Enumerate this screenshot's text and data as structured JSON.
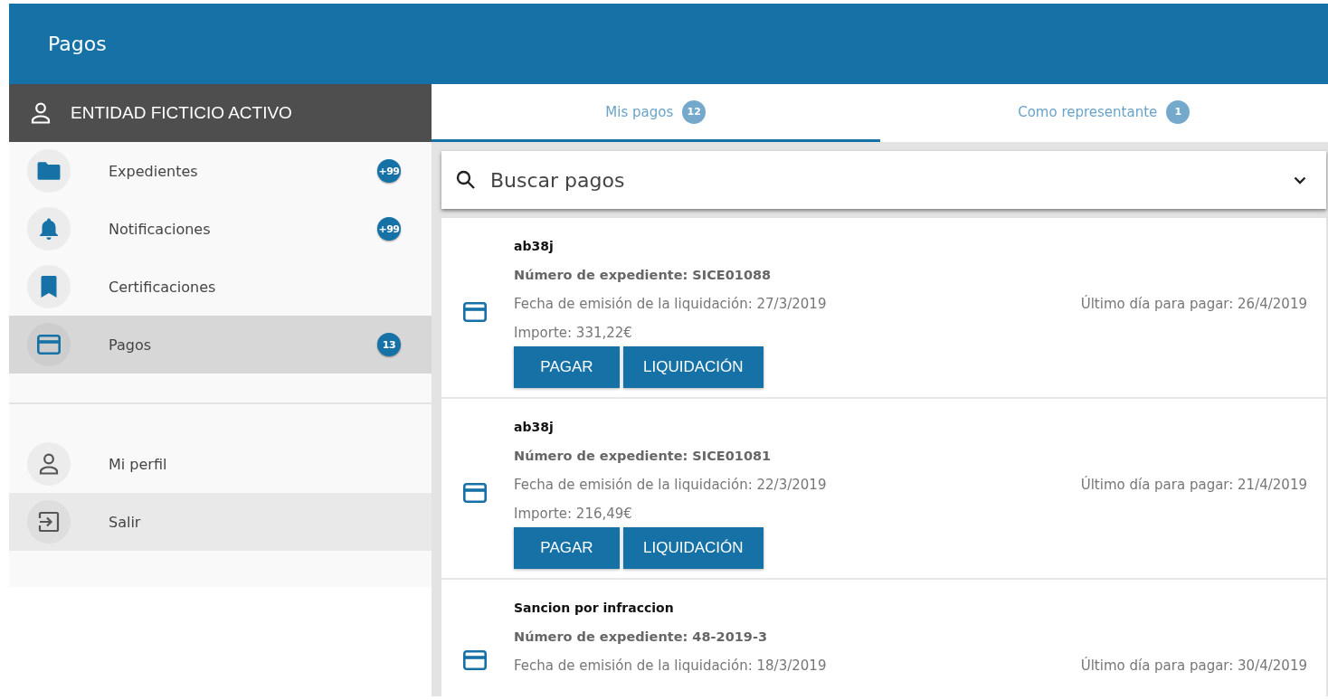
{
  "header": {
    "title": "Pagos"
  },
  "account": {
    "name": "ENTIDAD FICTICIO ACTIVO"
  },
  "sidebar": {
    "items": [
      {
        "kind": "folder",
        "label": "Expedientes",
        "badge": "+99",
        "selected": false,
        "hovered": false
      },
      {
        "kind": "bell",
        "label": "Notificaciones",
        "badge": "+99",
        "selected": false,
        "hovered": false
      },
      {
        "kind": "bookmark",
        "label": "Certificaciones",
        "selected": false,
        "hovered": false
      },
      {
        "kind": "card",
        "label": "Pagos",
        "badge": "13",
        "selected": true,
        "hovered": false
      }
    ],
    "bottom_items": [
      {
        "kind": "person",
        "label": "Mi perfil",
        "selected": false,
        "hovered": false
      },
      {
        "kind": "exit",
        "label": "Salir",
        "selected": false,
        "hovered": true
      }
    ]
  },
  "tabs": [
    {
      "label": "Mis pagos",
      "badge": "12",
      "selected": true
    },
    {
      "label": "Como representante",
      "badge": "1",
      "selected": false
    }
  ],
  "search": {
    "placeholder": "Buscar pagos"
  },
  "payments": [
    {
      "title": "ab38j",
      "expediente": "Número de expediente: SICE01088",
      "fecha": "Fecha de emisión de la liquidación: 27/3/2019",
      "ultimo": "Último día para pagar: 26/4/2019",
      "importe": "Importe: 331,22€",
      "buttons": [
        "PAGAR",
        "LIQUIDACIÓN"
      ]
    },
    {
      "title": "ab38j",
      "expediente": "Número de expediente: SICE01081",
      "fecha": "Fecha de emisión de la liquidación: 22/3/2019",
      "ultimo": "Último día para pagar: 21/4/2019",
      "importe": "Importe: 216,49€",
      "buttons": [
        "PAGAR",
        "LIQUIDACIÓN"
      ]
    },
    {
      "title": "Sancion por infraccion",
      "expediente": "Número de expediente: 48-2019-3",
      "fecha": "Fecha de emisión de la liquidación: 18/3/2019",
      "ultimo": "Último día para pagar: 30/4/2019"
    }
  ]
}
